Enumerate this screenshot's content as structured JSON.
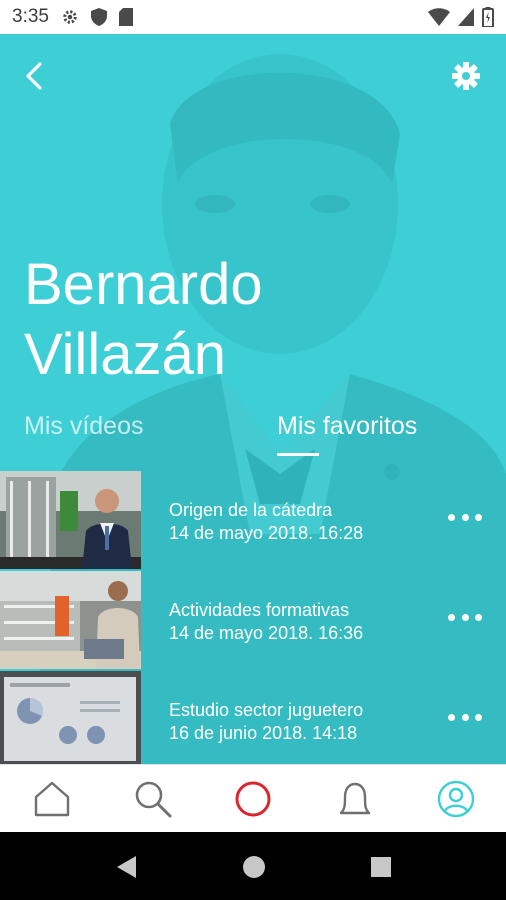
{
  "status_bar": {
    "time": "3:35",
    "icons": [
      "settings-icon",
      "shield-icon",
      "sd-card-icon",
      "wifi-icon",
      "signal-icon",
      "battery-icon"
    ]
  },
  "header": {
    "back_icon": "chevron-left-icon",
    "settings_icon": "gear-icon"
  },
  "profile": {
    "name_line1": "Bernardo",
    "name_line2": "Villazán"
  },
  "tabs": [
    {
      "label": "Mis vídeos",
      "active": false
    },
    {
      "label": "Mis favoritos",
      "active": true
    }
  ],
  "videos": [
    {
      "title": "Origen de la cátedra",
      "date": "14 de mayo 2018.   16:28"
    },
    {
      "title": "Actividades formativas",
      "date": "14 de mayo 2018.   16:36"
    },
    {
      "title": "Estudio sector juguetero",
      "date": "16 de junio 2018.   14:18"
    }
  ],
  "bottom_nav": {
    "items": [
      "home-icon",
      "search-icon",
      "record-icon",
      "bell-icon",
      "profile-icon"
    ],
    "active": "profile-icon"
  },
  "colors": {
    "hero_bg": "#3dcfd5",
    "record_accent": "#d9262e",
    "active_nav": "#3dcfd5",
    "inactive_nav": "#707070"
  }
}
